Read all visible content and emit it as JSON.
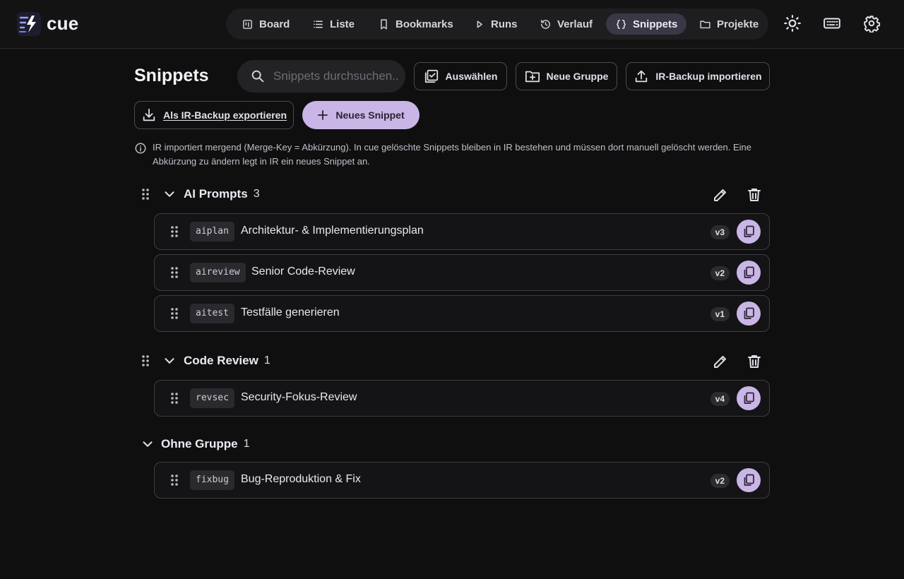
{
  "app": {
    "name": "cue"
  },
  "nav": {
    "board": "Board",
    "liste": "Liste",
    "bookmarks": "Bookmarks",
    "runs": "Runs",
    "verlauf": "Verlauf",
    "snippets": "Snippets",
    "projekte": "Projekte",
    "active": "snippets"
  },
  "page": {
    "title": "Snippets",
    "search_placeholder": "Snippets durchsuchen..",
    "select_label": "Auswählen",
    "new_group_label": "Neue Gruppe",
    "import_label": "IR-Backup importieren",
    "export_label": "Als IR-Backup exportieren",
    "new_snippet_label": "Neues Snippet",
    "info_text": "IR importiert mergend (Merge-Key = Abkürzung). In cue gelöschte Snippets bleiben in IR bestehen und müssen dort manuell gelöscht werden. Eine Abkürzung zu ändern legt in IR ein neues Snippet an."
  },
  "groups": [
    {
      "name": "AI Prompts",
      "count": "3",
      "snippets": [
        {
          "abbr": "aiplan",
          "title": "Architektur- & Implementierungsplan",
          "version": "v3"
        },
        {
          "abbr": "aireview",
          "title": "Senior Code-Review",
          "version": "v2"
        },
        {
          "abbr": "aitest",
          "title": "Testfälle generieren",
          "version": "v1"
        }
      ]
    },
    {
      "name": "Code Review",
      "count": "1",
      "snippets": [
        {
          "abbr": "revsec",
          "title": "Security-Fokus-Review",
          "version": "v4"
        }
      ]
    },
    {
      "name": "Ohne Gruppe",
      "count": "1",
      "snippets": [
        {
          "abbr": "fixbug",
          "title": "Bug-Reproduktion & Fix",
          "version": "v2"
        }
      ]
    }
  ],
  "colors": {
    "background": "#0f0f10",
    "accent": "#c9b5e6",
    "active_nav": "#3a3746",
    "border": "#3d3c43"
  },
  "icons": {
    "logo": "cue-logo-icon",
    "board": "board-icon",
    "list": "list-icon",
    "bookmark": "bookmark-icon",
    "runs": "play-icon",
    "history": "history-icon",
    "snippets": "braces-icon",
    "projects": "folder-icon",
    "theme": "sun-icon",
    "keyboard": "keyboard-icon",
    "settings": "gear-icon",
    "search": "search-icon",
    "select": "select-checkbox-icon",
    "new_group": "folder-plus-icon",
    "import": "upload-icon",
    "export": "download-icon",
    "add": "plus-icon",
    "info": "info-icon",
    "drag": "drag-handle-icon",
    "expand": "chevron-down-icon",
    "edit": "pencil-icon",
    "delete": "trash-icon",
    "copy": "copy-icon"
  }
}
